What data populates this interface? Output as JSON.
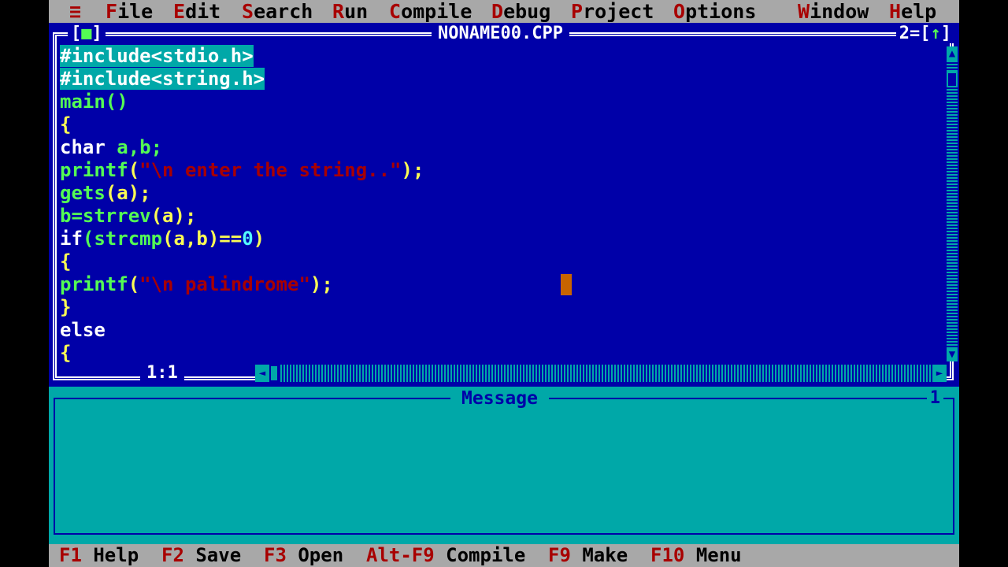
{
  "menu": [
    {
      "hot": "≡",
      "rest": ""
    },
    {
      "hot": "F",
      "rest": "ile"
    },
    {
      "hot": "E",
      "rest": "dit"
    },
    {
      "hot": "S",
      "rest": "earch"
    },
    {
      "hot": "R",
      "rest": "un"
    },
    {
      "hot": "C",
      "rest": "ompile"
    },
    {
      "hot": "D",
      "rest": "ebug"
    },
    {
      "hot": "P",
      "rest": "roject"
    },
    {
      "hot": "O",
      "rest": "ptions"
    },
    {
      "hot": "W",
      "rest": "indow"
    },
    {
      "hot": "H",
      "rest": "elp"
    }
  ],
  "editor": {
    "close_left": "[",
    "close_glyph": "■",
    "close_right": "]",
    "title": "NONAME00.CPP",
    "window_number": "2",
    "zoom_left": "[",
    "zoom_glyph": "↑",
    "zoom_right": "]",
    "position": "1:1",
    "lines": {
      "l1": "#include<stdio.h>",
      "l2": "#include<string.h>",
      "l3": "main()",
      "l4": "{",
      "l5_kw": "char",
      "l5_rest": " a,b;",
      "l6_fn": "printf",
      "l6_open": "(",
      "l6_str": "\"\\n enter the string..\"",
      "l6_close": ");",
      "l7_fn": "gets",
      "l7_rest": "(a);",
      "l8_a": "b=strrev",
      "l8_b": "(a);",
      "l9_kw": "if",
      "l9_a": "(strcmp",
      "l9_b": "(a,b)==",
      "l9_num": "0",
      "l9_c": ")",
      "l10": "{",
      "l11_fn": "printf",
      "l11_open": "(",
      "l11_str": "\"\\n palindrome\"",
      "l11_close": ");",
      "l12": "}",
      "l13": "else",
      "l14": "{"
    },
    "scroll_up": "▲",
    "scroll_down": "▼",
    "scroll_left": "◄",
    "scroll_right": "►"
  },
  "message": {
    "title": "Message",
    "number": "1"
  },
  "status": [
    {
      "key": "F1",
      "label": "Help"
    },
    {
      "key": "F2",
      "label": "Save"
    },
    {
      "key": "F3",
      "label": "Open"
    },
    {
      "key": "Alt-F9",
      "label": "Compile"
    },
    {
      "key": "F9",
      "label": "Make"
    },
    {
      "key": "F10",
      "label": "Menu"
    }
  ],
  "colors": {
    "background": "#0000a8",
    "menu_bar": "#a8a8a8",
    "hotkey": "#a80000",
    "message_bg": "#00a8a8",
    "cursor": "#c86400"
  }
}
